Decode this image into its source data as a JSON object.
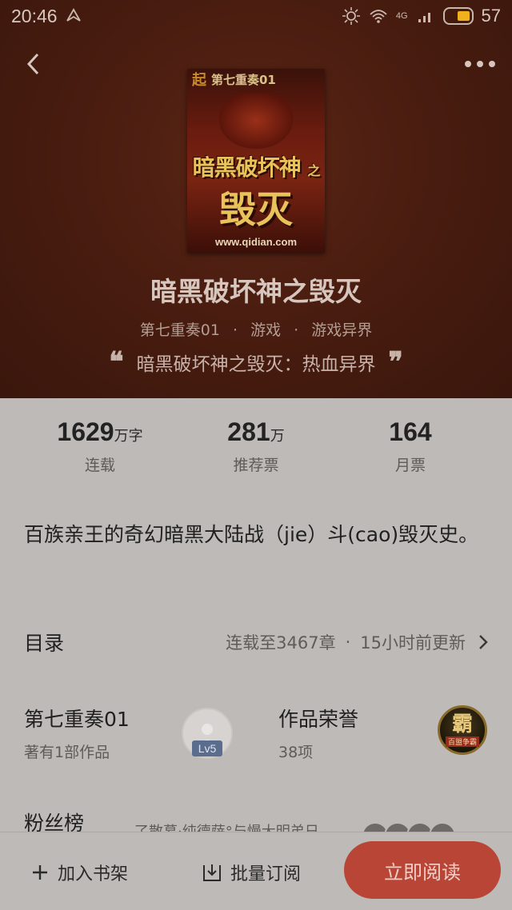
{
  "status_bar": {
    "time": "20:46",
    "network": "4G",
    "battery": "57"
  },
  "book": {
    "cover": {
      "series_label": "第七重奏01",
      "logo": "起",
      "title_line1": "暗黑破坏神",
      "title_mid": "之",
      "title_line2": "毁灭",
      "url": "www.qidian.com"
    },
    "title": "暗黑破坏神之毁灭",
    "author": "第七重奏01",
    "category": "游戏",
    "subcategory": "游戏异界",
    "tagline": "暗黑破坏神之毁灭：热血异界"
  },
  "stats": [
    {
      "num": "1629",
      "unit": "万字",
      "label": "连载"
    },
    {
      "num": "281",
      "unit": "万",
      "label": "推荐票"
    },
    {
      "num": "164",
      "unit": "",
      "label": "月票"
    }
  ],
  "intro": "百族亲王的奇幻暗黑大陆战（jie）斗(cao)毁灭史。",
  "toc": {
    "title": "目录",
    "progress": "连载至3467章",
    "updated": "15小时前更新"
  },
  "author_info": {
    "name": "第七重奏01",
    "works": "著有1部作品",
    "level": "Lv5"
  },
  "honor": {
    "title": "作品荣誉",
    "count": "38项",
    "medal_glyph": "霸",
    "medal_ribbon": "百盟争霸"
  },
  "fans": {
    "title": "粉丝榜",
    "names": "⁠了散慕·纯德萨°与慢大明弟日"
  },
  "bottom": {
    "add_shelf": "加入书架",
    "bulk_subscribe": "批量订阅",
    "read_now": "立即阅读"
  },
  "colors": {
    "accent": "#b84535",
    "hero_bg": "#4a1d10"
  }
}
